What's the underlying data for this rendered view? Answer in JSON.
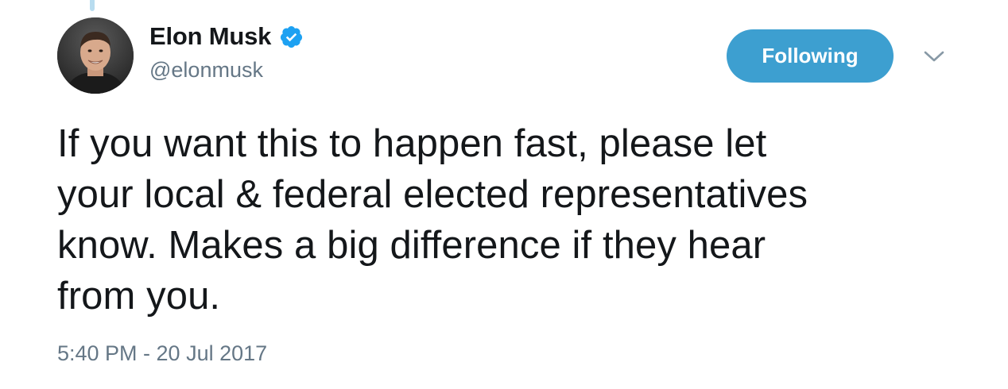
{
  "tweet": {
    "author": {
      "display_name": "Elon Musk",
      "handle": "@elonmusk",
      "verified": true,
      "verified_color": "#1da1f2"
    },
    "follow_button_label": "Following",
    "follow_button_color": "#3d9fd0",
    "text": "If you want this to happen fast, please let\nyour local & federal elected representatives\nknow. Makes a big difference if they hear\nfrom you.",
    "timestamp": "5:40 PM - 20 Jul 2017",
    "icons": {
      "verified": "verified-badge-icon",
      "caret": "chevron-down-icon"
    }
  }
}
